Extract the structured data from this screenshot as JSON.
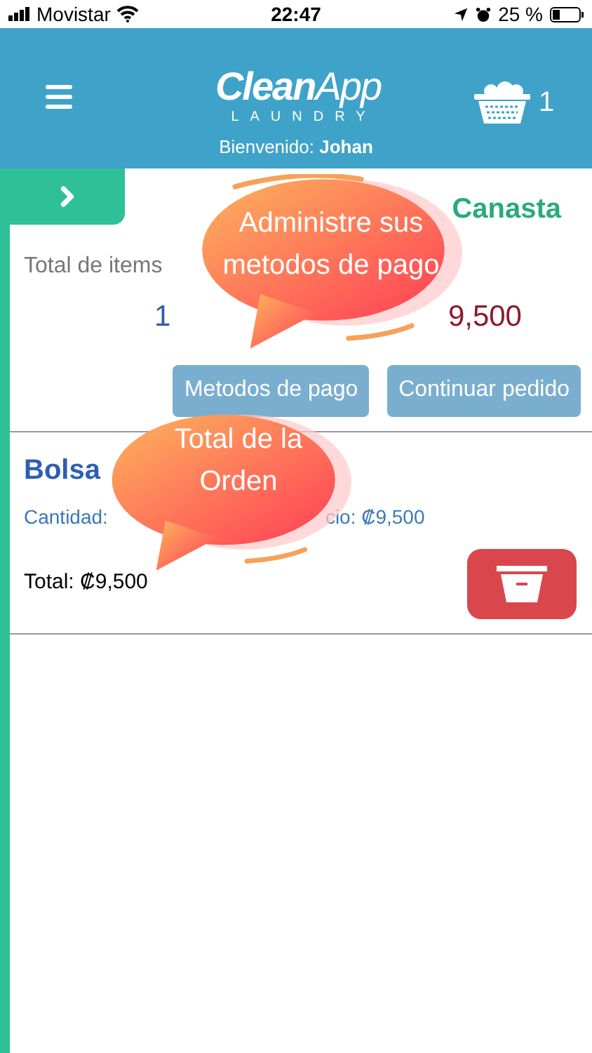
{
  "status_bar": {
    "carrier": "Movistar",
    "time": "22:47",
    "battery": "25 %"
  },
  "header": {
    "logo_main": "Clean",
    "logo_app": "App",
    "logo_sub": "LAUNDRY",
    "basket_count": "1",
    "welcome_label": "Bienvenido:",
    "welcome_name": "Johan"
  },
  "cart": {
    "title": "Canasta",
    "items_label": "Total de items",
    "items_count": "1",
    "total": "9,500",
    "buttons": [
      "Metodos de pago",
      "Continuar pedido"
    ]
  },
  "order_items": [
    {
      "name": "Bolsa",
      "quantity": "Cantidad:",
      "price": "cio: ₡9,500",
      "total": "Total: ₡9,500"
    }
  ],
  "callouts": [
    {
      "text": "Administre sus metodos de pago"
    },
    {
      "text": "Total de la Orden"
    }
  ]
}
